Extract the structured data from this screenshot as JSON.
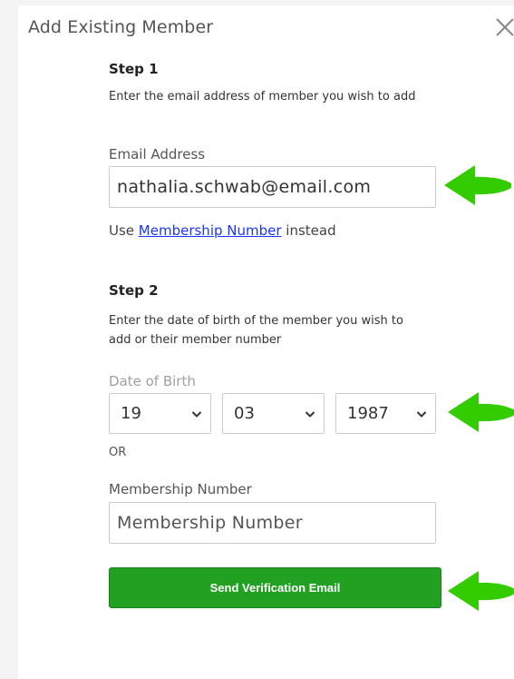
{
  "modal": {
    "title": "Add Existing Member",
    "close_icon": "close-icon"
  },
  "step1": {
    "heading": "Step 1",
    "instruction": "Enter the email address of member you wish to add",
    "email_label": "Email Address",
    "email_value": "nathalia.schwab@email.com",
    "alt_prefix": "Use ",
    "alt_link": "Membership Number",
    "alt_suffix": " instead"
  },
  "step2": {
    "heading": "Step 2",
    "instruction": "Enter the date of birth of the member you wish to add or their member number",
    "dob_label": "Date of Birth",
    "dob_day": "19",
    "dob_month": "03",
    "dob_year": "1987",
    "or_text": "OR",
    "membership_label": "Membership Number",
    "membership_placeholder": "Membership Number"
  },
  "actions": {
    "send_label": "Send Verification Email"
  },
  "annotations": {
    "arrow_color": "#33cc00",
    "arrow_icon": "left-arrow-icon"
  },
  "colors": {
    "button_green": "#21a021",
    "link_blue": "#1a35ff"
  }
}
